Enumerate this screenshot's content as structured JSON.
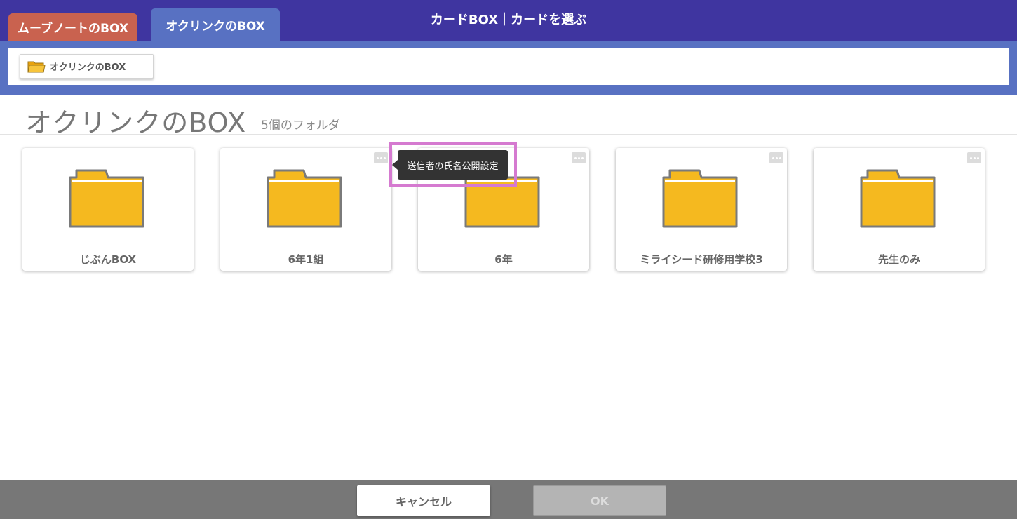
{
  "header": {
    "tabs": [
      {
        "label": "ムーブノートのBOX",
        "color": "#c9624f"
      },
      {
        "label": "オクリンクのBOX",
        "color": "#5871c2",
        "active": true
      }
    ],
    "title": "カードBOX｜カードを選ぶ",
    "color": "#3f35a0"
  },
  "breadcrumb": {
    "items": [
      {
        "label": "オクリンクのBOX",
        "icon": "folder-icon"
      }
    ]
  },
  "page": {
    "title": "オクリンクのBOX",
    "count": "5個のフォルダ"
  },
  "folders": [
    {
      "label": "じぶんBOX",
      "has_menu": false
    },
    {
      "label": "6年1組",
      "has_menu": true
    },
    {
      "label": "6年",
      "has_menu": true
    },
    {
      "label": "ミライシード研修用学校3",
      "has_menu": true
    },
    {
      "label": "先生のみ",
      "has_menu": true
    }
  ],
  "tooltip": {
    "text": "送信者の氏名公開設定"
  },
  "footer": {
    "cancel_label": "キャンセル",
    "ok_label": "OK"
  },
  "colors": {
    "folder_fill": "#f5b91f",
    "highlight": "#d57ad0"
  }
}
